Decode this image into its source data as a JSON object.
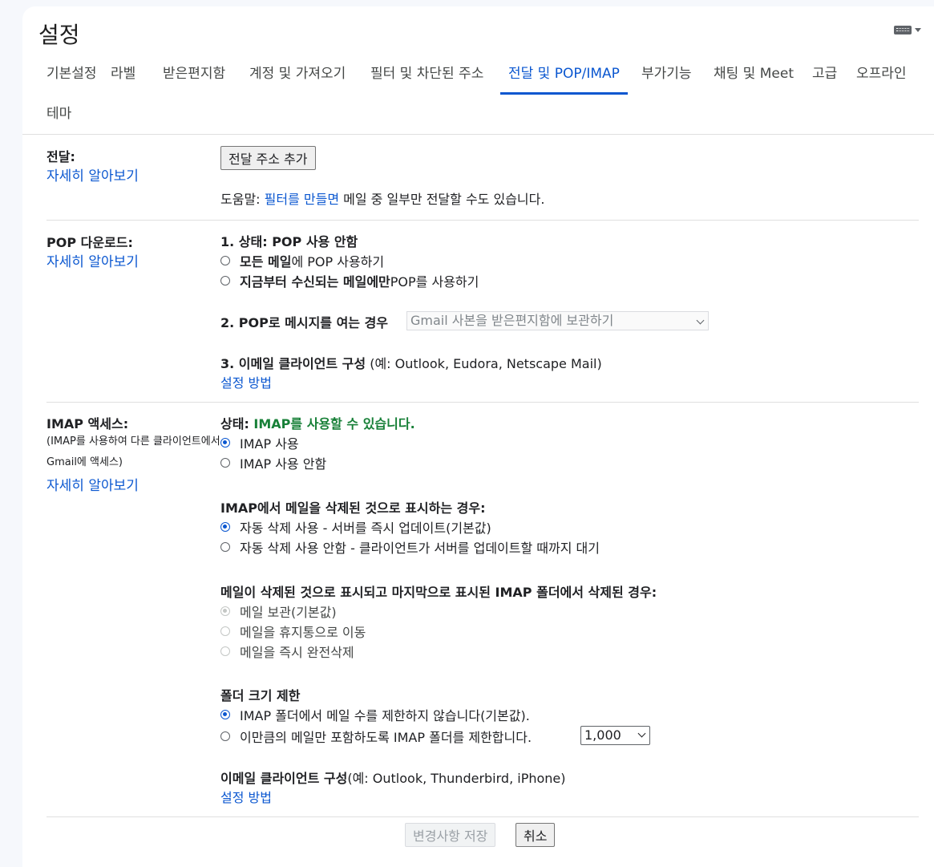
{
  "header": {
    "title": "설정"
  },
  "tabs": [
    {
      "label": "기본설정"
    },
    {
      "label": "라벨"
    },
    {
      "label": "받은편지함"
    },
    {
      "label": "계정 및 가져오기"
    },
    {
      "label": "필터 및 차단된 주소"
    },
    {
      "label": "전달 및 POP/IMAP",
      "active": true
    },
    {
      "label": "부가기능"
    },
    {
      "label": "채팅 및 Meet"
    },
    {
      "label": "고급"
    },
    {
      "label": "오프라인"
    },
    {
      "label": "테마"
    }
  ],
  "forwarding": {
    "label": "전달:",
    "learn_more": "자세히 알아보기",
    "add_button": "전달 주소 추가",
    "tip_prefix": "도움말: ",
    "tip_link": "필터를 만들면",
    "tip_suffix": " 메일 중 일부만 전달할 수도 있습니다."
  },
  "pop": {
    "label": "POP 다운로드:",
    "learn_more": "자세히 알아보기",
    "status": "1. 상태: POP 사용 안함",
    "opt1_bold": "모든 메일",
    "opt1_rest": "에 POP 사용하기",
    "opt2_bold": "지금부터 수신되는 메일에만",
    "opt2_rest": " POP를 사용하기",
    "when_label": "2. POP로 메시지를 여는 경우",
    "when_select": "Gmail 사본을 받은편지함에 보관하기",
    "config_bold": "3. 이메일 클라이언트 구성",
    "config_rest": " (예: Outlook, Eudora, Netscape Mail)",
    "config_link": "설정 방법"
  },
  "imap": {
    "label": "IMAP 액세스:",
    "sub": "(IMAP를 사용하여 다른 클라이언트에서 Gmail에 액세스)",
    "learn_more": "자세히 알아보기",
    "status_label": "상태: ",
    "status_value": "IMAP를 사용할 수 있습니다.",
    "enable": "IMAP 사용",
    "disable": "IMAP 사용 안함",
    "deleted_title": "IMAP에서 메일을 삭제된 것으로 표시하는 경우:",
    "autoexpunge_on": "자동 삭제 사용 - 서버를 즉시 업데이트(기본값)",
    "autoexpunge_off": "자동 삭제 사용 안함 - 클라이언트가 서버를 업데이트할 때까지 대기",
    "expunged_title": "메일이 삭제된 것으로 표시되고 마지막으로 표시된 IMAP 폴더에서 삭제된 경우:",
    "archive": "메일 보관(기본값)",
    "trash": "메일을 휴지통으로 이동",
    "delete_forever": "메일을 즉시 완전삭제",
    "folder_title": "폴더 크기 제한",
    "no_limit": "IMAP 폴더에서 메일 수를 제한하지 않습니다(기본값).",
    "limit": "이만큼의 메일만 포함하도록 IMAP 폴더를 제한합니다.",
    "limit_value": "1,000",
    "config_bold": "이메일 클라이언트 구성",
    "config_rest": "(예: Outlook, Thunderbird, iPhone)",
    "config_link": "설정 방법"
  },
  "footer": {
    "save": "변경사항 저장",
    "cancel": "취소"
  },
  "colors": {
    "accent": "#0b57d0",
    "status_green": "#188038"
  }
}
